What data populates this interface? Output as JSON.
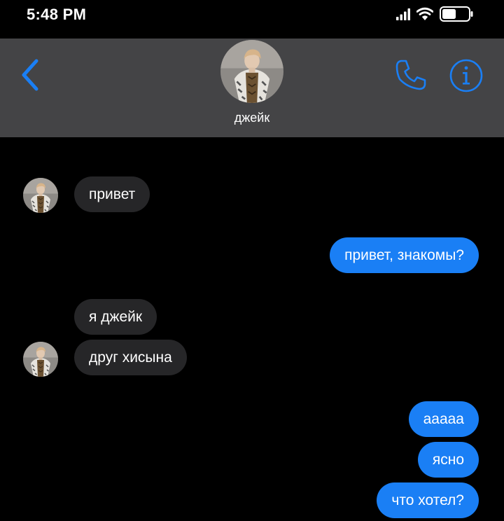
{
  "status_bar": {
    "time": "5:48 PM",
    "icons": [
      "signal-icon",
      "wifi-icon",
      "battery-icon"
    ]
  },
  "header": {
    "contact_name": "джейк",
    "icons": [
      "chevron-left-icon",
      "phone-icon",
      "info-icon"
    ],
    "accent_color": "#1a7ff5",
    "background_color": "#444446"
  },
  "messages": [
    {
      "from": "contact",
      "text": "привет"
    },
    {
      "from": "me",
      "text": "привет, знакомы?"
    },
    {
      "from": "contact",
      "text": "я джейк"
    },
    {
      "from": "contact",
      "text": "друг хисына"
    },
    {
      "from": "me",
      "text": "ааааа"
    },
    {
      "from": "me",
      "text": "ясно"
    },
    {
      "from": "me",
      "text": "что хотел?"
    }
  ],
  "colors": {
    "incoming_bubble": "#262628",
    "outgoing_bubble": "#1a7ff5",
    "background": "#000000"
  }
}
